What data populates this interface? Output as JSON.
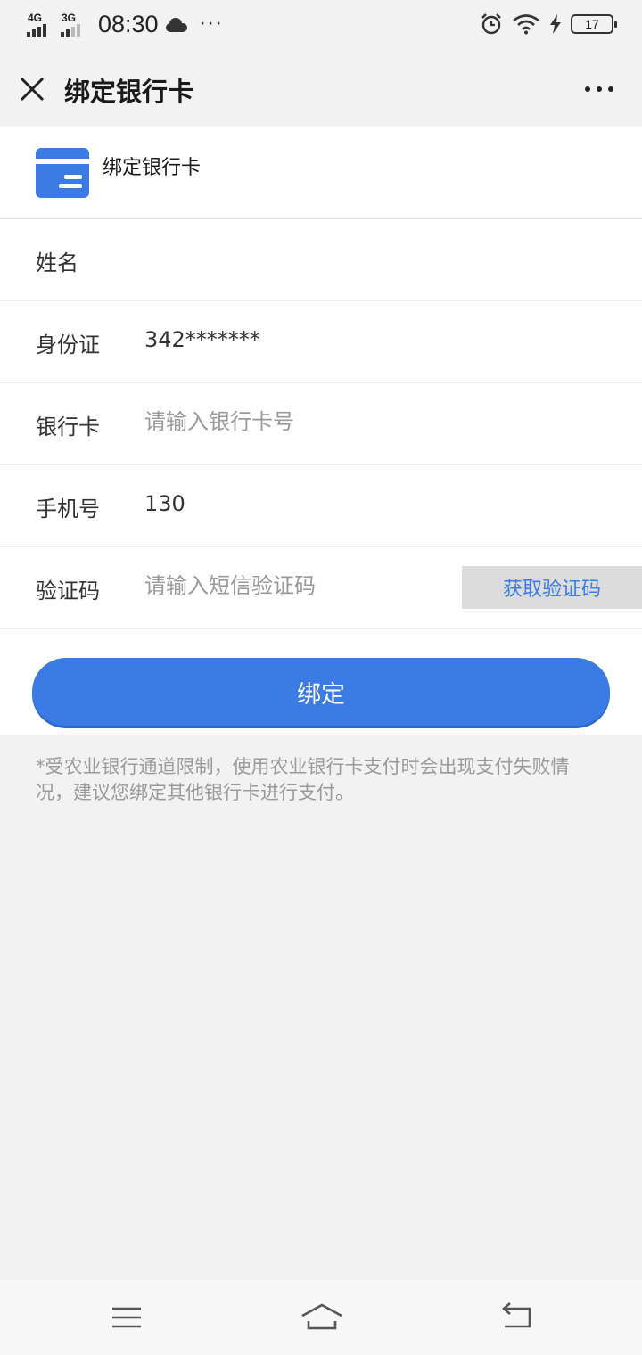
{
  "status_bar": {
    "network1": "4G",
    "network2": "3G",
    "time": "08:30",
    "more": "···",
    "battery": "17"
  },
  "header": {
    "title": "绑定银行卡"
  },
  "card_section": {
    "label": "绑定银行卡"
  },
  "form": {
    "name": {
      "label": "姓名",
      "value": ""
    },
    "id_card": {
      "label": "身份证",
      "value": "342*******"
    },
    "bank_card": {
      "label": "银行卡",
      "placeholder": "请输入银行卡号"
    },
    "phone": {
      "label": "手机号",
      "value": "130"
    },
    "code": {
      "label": "验证码",
      "placeholder": "请输入短信验证码",
      "button": "获取验证码"
    }
  },
  "submit_label": "绑定",
  "notice": "*受农业银行通道限制，使用农业银行卡支付时会出现支付失败情况，建议您绑定其他银行卡进行支付。",
  "colors": {
    "accent": "#3b7be3",
    "background": "#f2f2f2"
  }
}
